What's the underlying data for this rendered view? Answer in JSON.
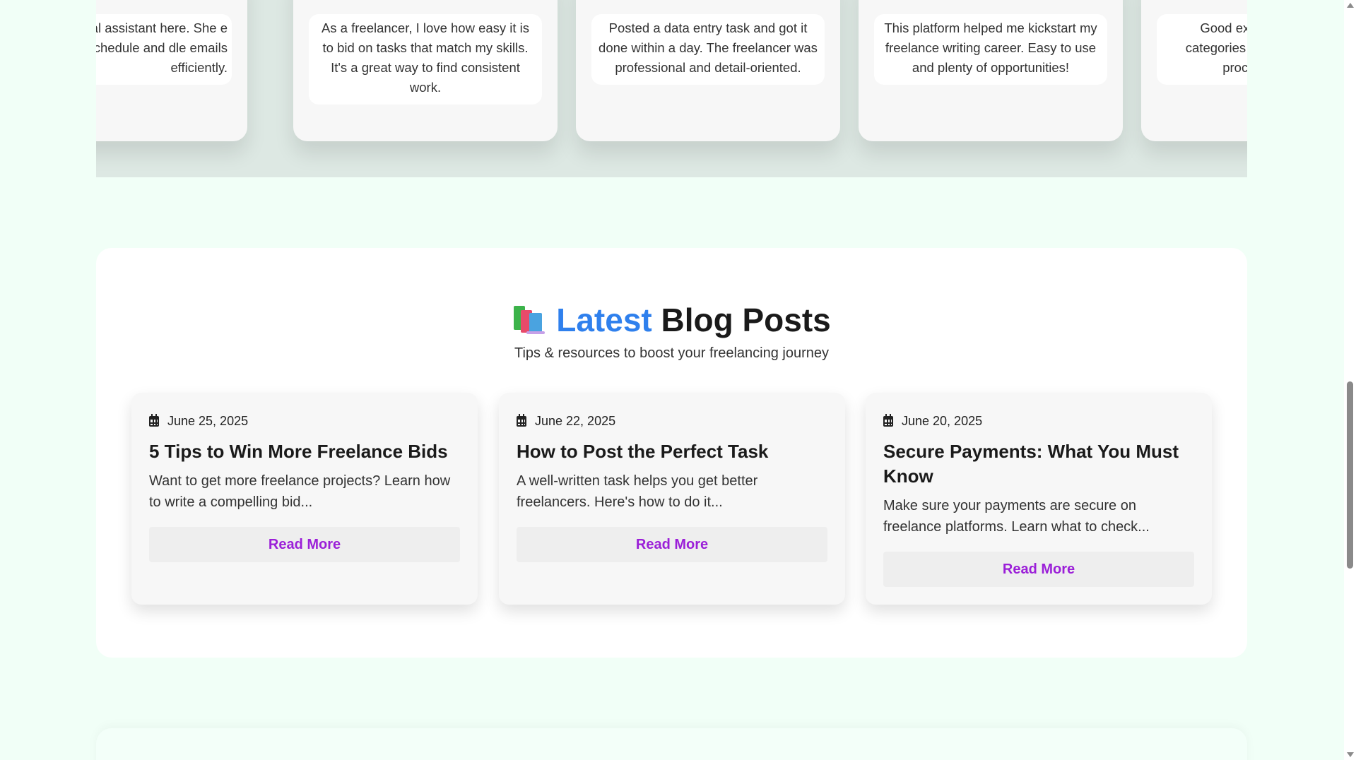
{
  "testimonials": [
    {
      "quote": "led virtual assistant here. She e organize my schedule and dle emails efficiently."
    },
    {
      "quote": "As a freelancer, I love how easy it is to bid on tasks that match my skills. It's a great way to find consistent work."
    },
    {
      "quote": "Posted a data entry task and got it done within a day. The freelancer was professional and detail-oriented."
    },
    {
      "quote": "This platform helped me kickstart my freelance writing career. Easy to use and plenty of opportunities!"
    },
    {
      "quote": "Good exper categories are process"
    }
  ],
  "blog": {
    "icon": "books-icon",
    "title_accent": "Latest",
    "title_rest": "Blog Posts",
    "subtitle": "Tips & resources to boost your freelancing journey",
    "accent_color": "#2f80ed",
    "link_color": "#9b1fd8",
    "posts": [
      {
        "date": "June 25, 2025",
        "title": "5 Tips to Win More Freelance Bids",
        "excerpt": "Want to get more freelance projects? Learn how to write a compelling bid...",
        "cta": "Read More"
      },
      {
        "date": "June 22, 2025",
        "title": "How to Post the Perfect Task",
        "excerpt": "A well-written task helps you get better freelancers. Here's how to do it...",
        "cta": "Read More"
      },
      {
        "date": "June 20, 2025",
        "title": "Secure Payments: What You Must Know",
        "excerpt": "Make sure your payments are secure on freelance platforms. Learn what to check...",
        "cta": "Read More"
      }
    ]
  }
}
